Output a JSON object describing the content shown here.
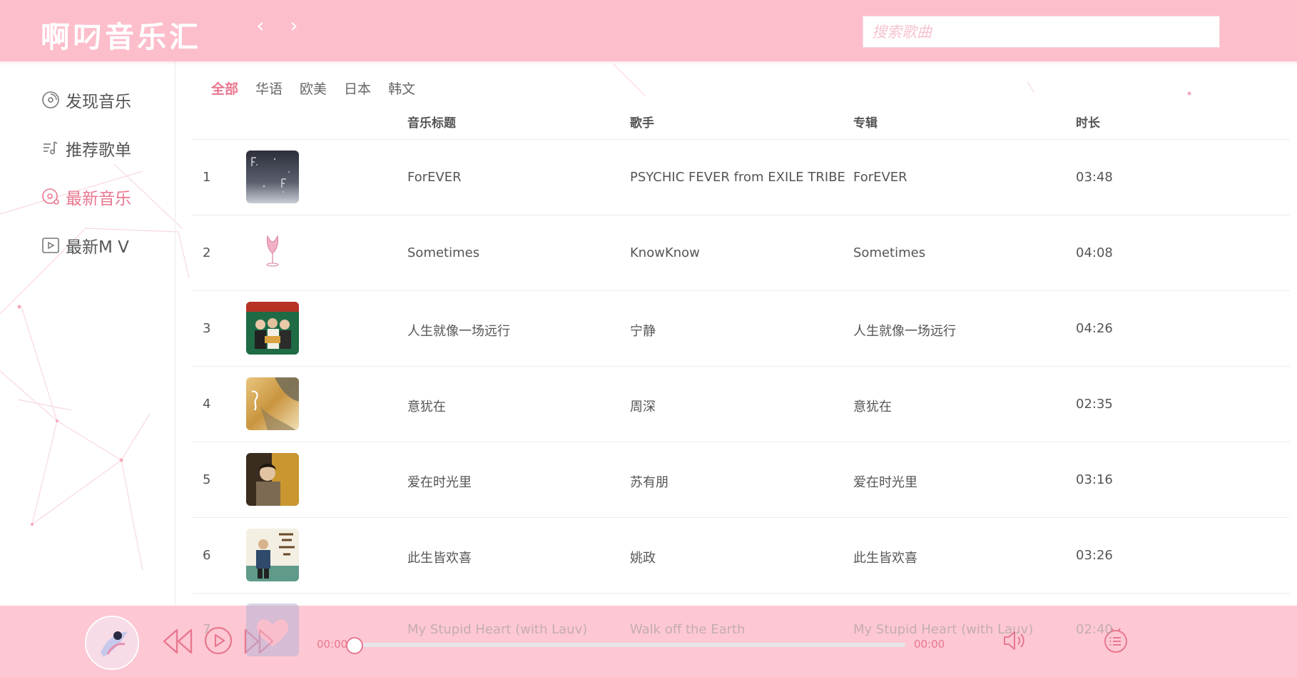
{
  "app": {
    "logo": "啊叼音乐汇",
    "back_icon": "chevron-left-icon",
    "forward_icon": "chevron-right-icon",
    "back_glyph": "‹",
    "forward_glyph": "›"
  },
  "search": {
    "placeholder": "搜索歌曲",
    "value": ""
  },
  "sidebar": {
    "items": [
      {
        "label": "发现音乐",
        "icon": "disc-icon",
        "active": false
      },
      {
        "label": "推荐歌单",
        "icon": "playlist-icon",
        "active": false
      },
      {
        "label": "最新音乐",
        "icon": "music-note-icon",
        "active": true
      },
      {
        "label": "最新M V",
        "icon": "video-icon",
        "active": false
      }
    ]
  },
  "tabs": [
    {
      "label": "全部",
      "active": true
    },
    {
      "label": "华语",
      "active": false
    },
    {
      "label": "欧美",
      "active": false
    },
    {
      "label": "日本",
      "active": false
    },
    {
      "label": "韩文",
      "active": false
    }
  ],
  "table": {
    "headers": {
      "title": "音乐标题",
      "artist": "歌手",
      "album": "专辑",
      "duration": "时长"
    },
    "rows": [
      {
        "index": "1",
        "title": "ForEVER",
        "artist": "PSYCHIC FEVER from EXILE TRIBE",
        "album": "ForEVER",
        "duration": "03:48"
      },
      {
        "index": "2",
        "title": "Sometimes",
        "artist": "KnowKnow",
        "album": "Sometimes",
        "duration": "04:08"
      },
      {
        "index": "3",
        "title": "人生就像一场远行",
        "artist": "宁静",
        "album": "人生就像一场远行",
        "duration": "04:26"
      },
      {
        "index": "4",
        "title": "意犹在",
        "artist": "周深",
        "album": "意犹在",
        "duration": "02:35"
      },
      {
        "index": "5",
        "title": "爱在时光里",
        "artist": "苏有朋",
        "album": "爱在时光里",
        "duration": "03:16"
      },
      {
        "index": "6",
        "title": "此生皆欢喜",
        "artist": "姚政",
        "album": "此生皆欢喜",
        "duration": "03:26"
      },
      {
        "index": "7",
        "title": "My Stupid Heart (with Lauv)",
        "artist": "Walk off the Earth",
        "album": "My Stupid Heart (with Lauv)",
        "duration": "02:40"
      }
    ]
  },
  "player": {
    "current_time": "00:00",
    "total_time": "00:00",
    "progress_fraction": 0,
    "prev_icon": "rewind-icon",
    "play_icon": "play-icon",
    "next_icon": "fast-forward-icon",
    "volume_icon": "volume-icon",
    "list_icon": "playlist-menu-icon"
  },
  "colors": {
    "header_bg": "#fdbecb",
    "accent": "#e8778f",
    "player_bg": "#fdbecb"
  }
}
